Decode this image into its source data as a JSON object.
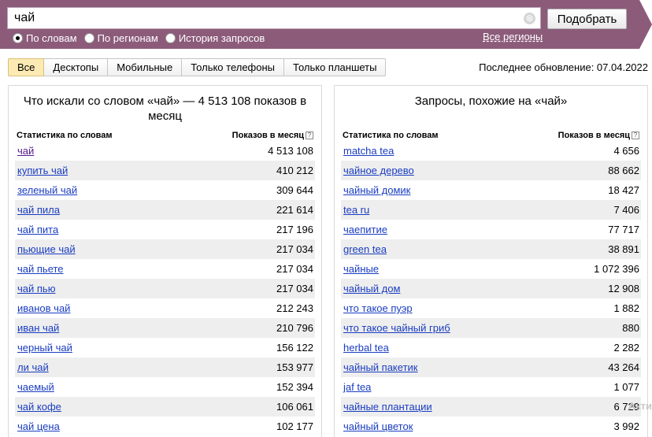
{
  "search": {
    "value": "чай",
    "clear_glyph": "⊗",
    "submit_label": "Подобрать"
  },
  "search_modes": [
    {
      "label": "По словам",
      "checked": true
    },
    {
      "label": "По регионам",
      "checked": false
    },
    {
      "label": "История запросов",
      "checked": false
    }
  ],
  "regions_link": "Все регионы",
  "device_tabs": [
    "Все",
    "Десктопы",
    "Мобильные",
    "Только телефоны",
    "Только планшеты"
  ],
  "active_tab": "Все",
  "last_update": "Последнее обновление: 07.04.2022",
  "left_panel": {
    "title": "Что искали со словом «чай» — 4 513 108 показов в месяц",
    "col_keyword": "Статистика по словам",
    "col_shows": "Показов в месяц",
    "rows": [
      {
        "keyword": "чай",
        "shows": "4 513 108"
      },
      {
        "keyword": "купить чай",
        "shows": "410 212"
      },
      {
        "keyword": "зеленый чай",
        "shows": "309 644"
      },
      {
        "keyword": "чай пила",
        "shows": "221 614"
      },
      {
        "keyword": "чай пита",
        "shows": "217 196"
      },
      {
        "keyword": "пьющие чай",
        "shows": "217 034"
      },
      {
        "keyword": "чай пьете",
        "shows": "217 034"
      },
      {
        "keyword": "чай пью",
        "shows": "217 034"
      },
      {
        "keyword": "иванов чай",
        "shows": "212 243"
      },
      {
        "keyword": "иван чай",
        "shows": "210 796"
      },
      {
        "keyword": "черный чай",
        "shows": "156 122"
      },
      {
        "keyword": "ли чай",
        "shows": "153 977"
      },
      {
        "keyword": "чаемый",
        "shows": "152 394"
      },
      {
        "keyword": "чай кофе",
        "shows": "106 061"
      },
      {
        "keyword": "чай цена",
        "shows": "102 177"
      }
    ]
  },
  "right_panel": {
    "title": "Запросы, похожие на «чай»",
    "col_keyword": "Статистика по словам",
    "col_shows": "Показов в месяц",
    "rows": [
      {
        "keyword": "matcha tea",
        "shows": "4 656"
      },
      {
        "keyword": "чайное дерево",
        "shows": "88 662"
      },
      {
        "keyword": "чайный домик",
        "shows": "18 427"
      },
      {
        "keyword": "tea ru",
        "shows": "7 406"
      },
      {
        "keyword": "чаепитие",
        "shows": "77 717"
      },
      {
        "keyword": "green tea",
        "shows": "38 891"
      },
      {
        "keyword": "чайные",
        "shows": "1 072 396"
      },
      {
        "keyword": "чайный дом",
        "shows": "12 908"
      },
      {
        "keyword": "что такое пуэр",
        "shows": "1 882"
      },
      {
        "keyword": "что такое чайный гриб",
        "shows": "880"
      },
      {
        "keyword": "herbal tea",
        "shows": "2 282"
      },
      {
        "keyword": "чайный пакетик",
        "shows": "43 264"
      },
      {
        "keyword": "jaf tea",
        "shows": "1 077"
      },
      {
        "keyword": "чайные плантации",
        "shows": "6 729"
      },
      {
        "keyword": "чайный цветок",
        "shows": "3 992"
      }
    ]
  },
  "help_glyph": "?",
  "watermark": "Акти",
  "colors": {
    "header": "#8c5b7a",
    "link": "#1a3dc1",
    "active_tab": "#fbeab3",
    "row_stripe": "#eeeeee"
  }
}
